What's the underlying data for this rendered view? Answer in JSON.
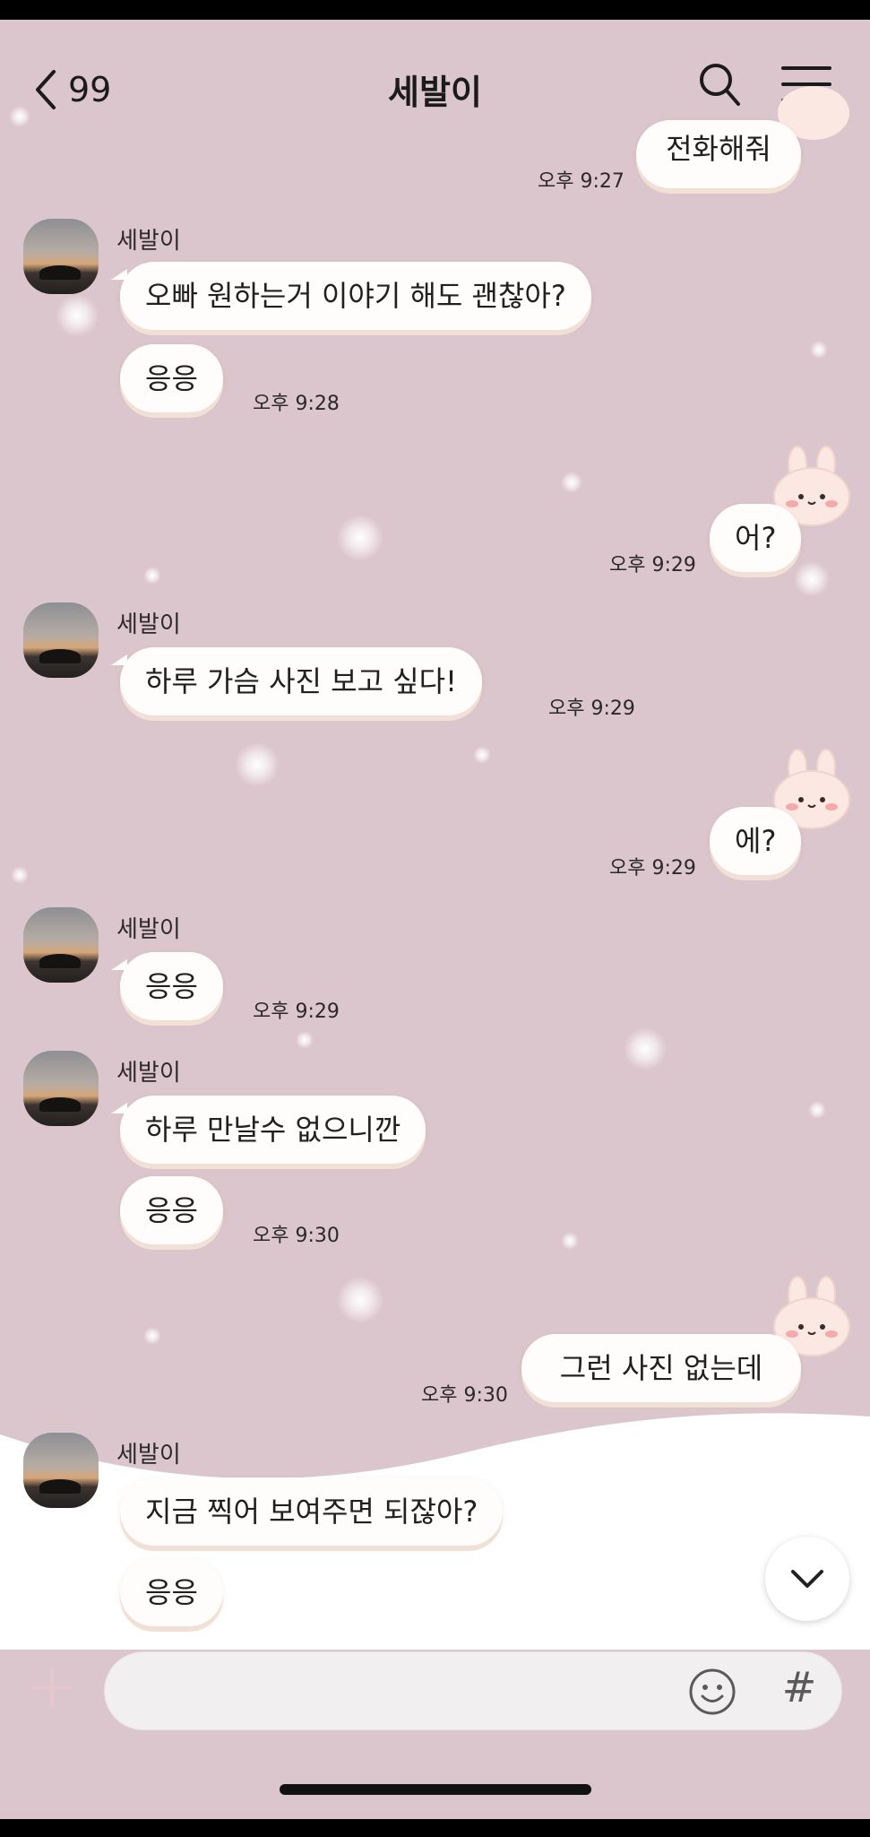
{
  "header": {
    "back_count": "99",
    "title": "세발이"
  },
  "messages": [
    {
      "side": "me",
      "text": "전화해줘",
      "time": "오후 9:27"
    },
    {
      "side": "other",
      "sender": "세발이",
      "text": "오빠  원하는거 이야기 해도 괜찮아?"
    },
    {
      "side": "other",
      "text": "응응",
      "time": "오후 9:28"
    },
    {
      "side": "me",
      "text": "어?",
      "time": "오후 9:29"
    },
    {
      "side": "other",
      "sender": "세발이",
      "text": "하루 가슴 사진 보고 싶다!",
      "time": "오후 9:29"
    },
    {
      "side": "me",
      "text": "에?",
      "time": "오후 9:29"
    },
    {
      "side": "other",
      "sender": "세발이",
      "text": "응응",
      "time": "오후 9:29"
    },
    {
      "side": "other",
      "sender": "세발이",
      "text": "하루 만날수 없으니깐"
    },
    {
      "side": "other",
      "text": "응응",
      "time": "오후 9:30"
    },
    {
      "side": "me",
      "text": "그런 사진 없는데",
      "time": "오후 9:30"
    },
    {
      "side": "other",
      "sender": "세발이",
      "text": "지금  찍어 보여주면 되잖아?"
    },
    {
      "side": "other",
      "text": "응응"
    }
  ],
  "composer": {
    "placeholder": "",
    "hash_label": "#"
  },
  "icons": {
    "back": "chevron-left-icon",
    "search": "search-icon",
    "menu": "hamburger-menu-icon",
    "plus": "plus-icon",
    "emoji": "smiley-icon",
    "scroll": "chevron-down-icon"
  },
  "colors": {
    "background": "#dcc6cd",
    "bubble": "#fffdfb",
    "wave": "#ffffff"
  }
}
